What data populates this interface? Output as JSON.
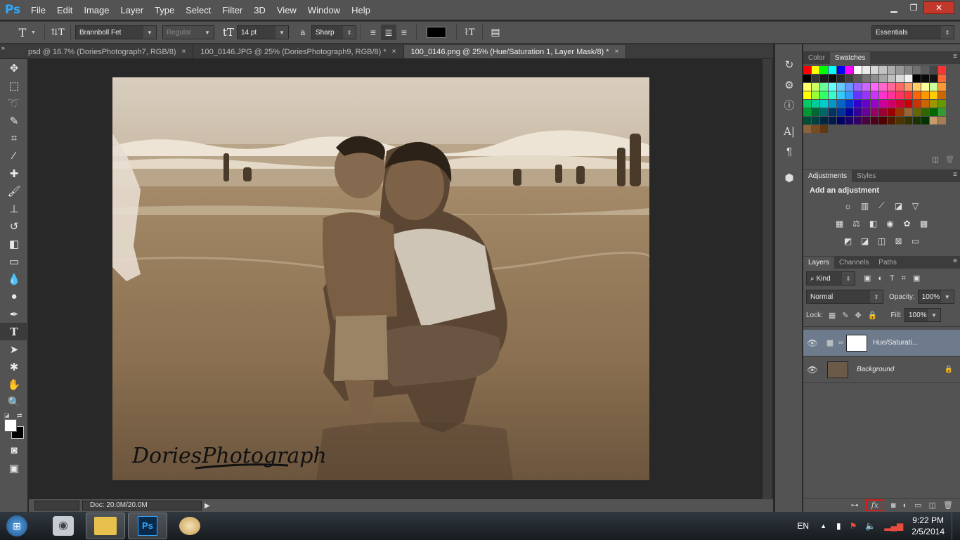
{
  "app": {
    "logo": "Ps"
  },
  "menu": [
    "File",
    "Edit",
    "Image",
    "Layer",
    "Type",
    "Select",
    "Filter",
    "3D",
    "View",
    "Window",
    "Help"
  ],
  "window_controls": {
    "minimize": "▁",
    "restore": "❐",
    "close": "✕"
  },
  "options_bar": {
    "font_family": "Brannboll Fet",
    "font_style": "Regular",
    "font_size": "14 pt",
    "aa_label": "a",
    "antialias": "Sharp",
    "workspace": "Essentials",
    "text_color": "#000000"
  },
  "doc_tabs": [
    {
      "label": "psd @ 16.7% (DoriesPhotograph7, RGB/8)",
      "close": "×",
      "active": false
    },
    {
      "label": "100_0146.JPG @ 25% (DoriesPhotograph9, RGB/8) *",
      "close": "×",
      "active": false
    },
    {
      "label": "100_0146.png @ 25% (Hue/Saturation 1, Layer Mask/8) *",
      "close": "×",
      "active": true
    }
  ],
  "status": {
    "doc_info": "Doc: 20.0M/20.0M"
  },
  "photo": {
    "watermark": "DoriesPhotograph"
  },
  "panels": {
    "color_tabs": [
      "Color",
      "Swatches"
    ],
    "adjustments_tabs": [
      "Adjustments",
      "Styles"
    ],
    "adjustments_title": "Add an adjustment",
    "layers_tabs": [
      "Layers",
      "Channels",
      "Paths"
    ],
    "kind_filter": "Kind",
    "blend_mode": "Normal",
    "opacity_label": "Opacity:",
    "opacity_value": "100%",
    "lock_label": "Lock:",
    "fill_label": "Fill:",
    "fill_value": "100%"
  },
  "layers": [
    {
      "name": "Hue/Saturati...",
      "selected": true
    },
    {
      "name": "Background",
      "selected": false
    }
  ],
  "swatches": [
    "#ff0000",
    "#ffff00",
    "#00ff00",
    "#00ffff",
    "#0000ff",
    "#ff00ff",
    "#ffffff",
    "#ebebeb",
    "#d6d6d6",
    "#c2c2c2",
    "#adadad",
    "#999999",
    "#858585",
    "#707070",
    "#5c5c5c",
    "#474747",
    "#ff3333",
    "#000000",
    "#333333",
    "#1a1a1a",
    "#0d0d0d",
    "#262626",
    "#404040",
    "#595959",
    "#737373",
    "#8c8c8c",
    "#a6a6a6",
    "#bfbfbf",
    "#d9d9d9",
    "#f2f2f2",
    "#000000",
    "#0a0a0a",
    "#141414",
    "#ff6633",
    "#ffff66",
    "#ccff66",
    "#66ff99",
    "#66ffff",
    "#66ccff",
    "#6699ff",
    "#9966ff",
    "#cc66ff",
    "#ff66ff",
    "#ff66cc",
    "#ff6699",
    "#ff6666",
    "#ff9966",
    "#ffcc66",
    "#ffff99",
    "#ccff99",
    "#ff9933",
    "#ffff00",
    "#99ff33",
    "#33ff66",
    "#33ffcc",
    "#33ccff",
    "#3399ff",
    "#6633ff",
    "#9933ff",
    "#cc33ff",
    "#ff33cc",
    "#ff3399",
    "#ff3366",
    "#ff3333",
    "#ff6600",
    "#ff9900",
    "#ffcc00",
    "#cc6600",
    "#00cc66",
    "#00cc99",
    "#00cccc",
    "#0099cc",
    "#0066cc",
    "#0033cc",
    "#3300cc",
    "#6600cc",
    "#9900cc",
    "#cc0099",
    "#cc0066",
    "#cc0033",
    "#cc0000",
    "#cc3300",
    "#cc6600",
    "#999900",
    "#669900",
    "#009933",
    "#006633",
    "#006666",
    "#003366",
    "#003399",
    "#000099",
    "#330099",
    "#660099",
    "#990066",
    "#990033",
    "#990000",
    "#993300",
    "#996633",
    "#666600",
    "#336600",
    "#006600",
    "#339933",
    "#004d33",
    "#004040",
    "#002640",
    "#001a4d",
    "#000066",
    "#1a0066",
    "#330066",
    "#4d0040",
    "#4d001a",
    "#4d0000",
    "#4d1a00",
    "#4d3300",
    "#333300",
    "#1a3300",
    "#003300",
    "#c69c6d",
    "#a67c52",
    "#8c6239",
    "#754c24",
    "#603913"
  ],
  "taskbar": {
    "lang": "EN",
    "time": "9:22 PM",
    "date": "2/5/2014"
  }
}
